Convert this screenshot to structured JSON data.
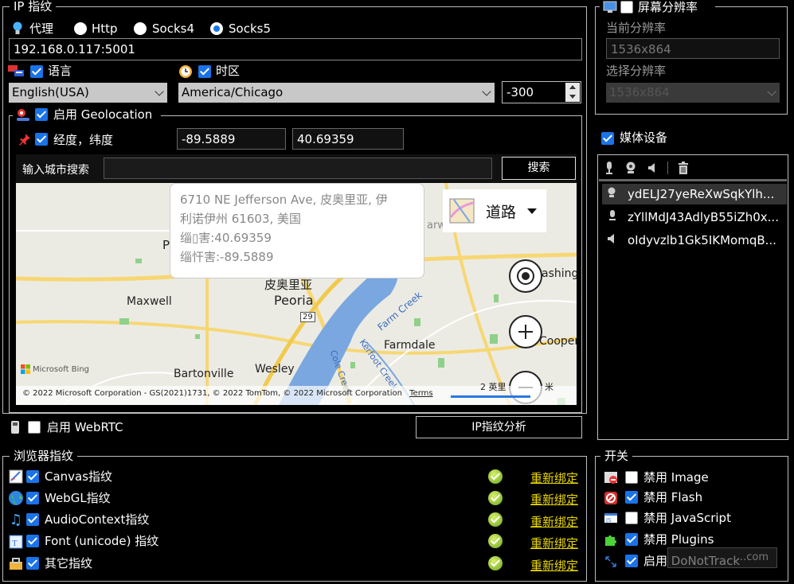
{
  "ip": {
    "legend": "IP 指纹",
    "proxy_label": "代理",
    "radios": [
      "Http",
      "Socks4",
      "Socks5"
    ],
    "address": "192.168.0.117:5001",
    "language_label": "语言",
    "language_value": "English(USA)",
    "timezone_label": "时区",
    "timezone_value": "America/Chicago",
    "offset_value": "-300",
    "geo_legend": "启用 Geolocation",
    "lonlat_label": "经度，纬度",
    "longitude": "-89.5889",
    "latitude": "40.69359",
    "city_search_label": "输入城市搜索",
    "search_button": "搜索",
    "webrtc_label": "启用 WebRTC",
    "analyze_button": "IP指纹分析"
  },
  "map": {
    "popup_line1": "6710 NE Jefferson Ave, 皮奥里亚, 伊",
    "popup_line2": "利诺伊州 61603, 美国",
    "popup_line3": "缁▯害:40.69359",
    "popup_line4": "缁忓害:-89.5889",
    "style_label": "道路",
    "places": [
      "Maxwell",
      "Peoria",
      "Farmdale",
      "Bartonville",
      "Wesley",
      "Cooper",
      "ashing",
      "arward Hills",
      "皮奥里亚",
      "P",
      "Farm Creek",
      "Kerfoot Creek",
      "Cole Creek",
      "29"
    ],
    "brand": "Microsoft Bing",
    "copyright": "© 2022 Microsoft Corporation - GS(2021)1731, © 2022 TomTom, © 2022 Microsoft Corporation",
    "terms": "Terms",
    "scale": "2 英里",
    "scale_unit": "米"
  },
  "screen": {
    "legend": "屏幕分辨率",
    "current_label": "当前分辨率",
    "current_value": "1536x864",
    "select_label": "选择分辨率",
    "select_value": "1536x864"
  },
  "media": {
    "label": "媒体设备",
    "devices": [
      "ydELJ27yeReXwSqkYlh...",
      "zYllMdJ43AdlyB55iZh0x...",
      "oIdyvzlb1Gk5IKMomqB..."
    ]
  },
  "browser": {
    "legend": "浏览器指纹",
    "rebind": "重新绑定",
    "items": [
      "Canvas指纹",
      "WebGL指纹",
      "AudioContext指纹",
      "Font (unicode) 指纹",
      "其它指纹"
    ]
  },
  "switches": {
    "legend": "开关",
    "items": [
      "禁用 Image",
      "禁用 Flash",
      "禁用 JavaScript",
      "禁用 Plugins",
      "启用 DoNotTrack"
    ]
  },
  "watermark": "...com"
}
